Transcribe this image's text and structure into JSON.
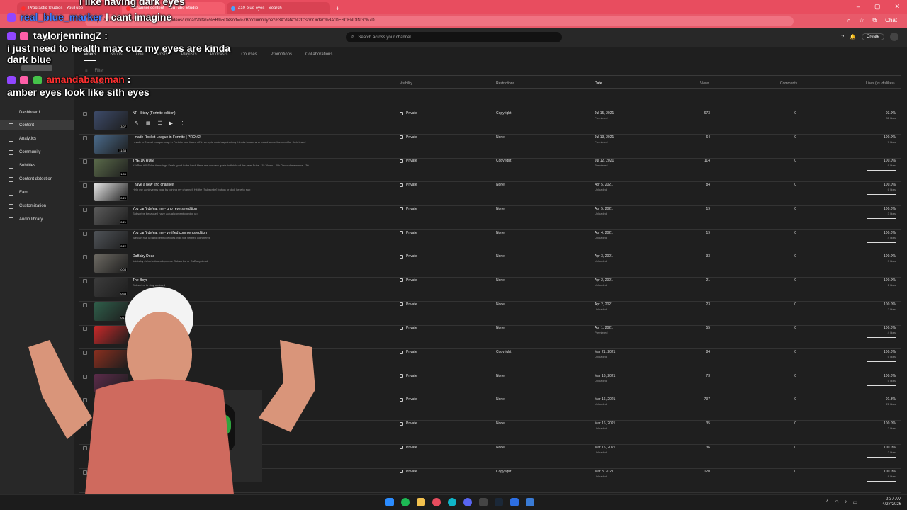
{
  "browser": {
    "tabs": [
      {
        "label": "Procrastic Studios - YouTube"
      },
      {
        "label": "Channel content - YouTube Studio"
      },
      {
        "label": "a10 blue eyes - Search"
      }
    ],
    "url": "https://studio.youtube.com/channel/UC.../videos/upload?filter=%5B%5D&sort=%7B\"columnType\"%3A\"date\"%2C\"sortOrder\"%3A\"DESCENDING\"%7D",
    "chat_button": "Chat"
  },
  "studio": {
    "search_placeholder": "Search across your channel",
    "create_label": "Create",
    "brand": "Studio"
  },
  "content_tabs": [
    "Videos",
    "Shorts",
    "Live",
    "Posts",
    "Playlists",
    "Podcasts",
    "Courses",
    "Promotions",
    "Collaborations"
  ],
  "filter_label": "Filter",
  "sidebar": {
    "items": [
      {
        "label": "Dashboard",
        "icon": "dashboard-icon"
      },
      {
        "label": "Content",
        "icon": "content-icon"
      },
      {
        "label": "Analytics",
        "icon": "analytics-icon"
      },
      {
        "label": "Community",
        "icon": "community-icon"
      },
      {
        "label": "Subtitles",
        "icon": "subtitles-icon"
      },
      {
        "label": "Content detection",
        "icon": "content-detection-icon"
      },
      {
        "label": "Earn",
        "icon": "earn-icon"
      },
      {
        "label": "Customization",
        "icon": "customization-icon"
      },
      {
        "label": "Audio library",
        "icon": "audio-library-icon"
      }
    ]
  },
  "columns": {
    "video": "Video",
    "visibility": "Visibility",
    "restrictions": "Restrictions",
    "date": "Date",
    "views": "Views",
    "comments": "Comments",
    "likes": "Likes (vs. dislikes)"
  },
  "rows": [
    {
      "title": "NF - Story (Fortnite edition)",
      "desc": "",
      "dur": "3:07",
      "vis": "Private",
      "restr": "Copyright",
      "date": "Jul 15, 2021",
      "sub": "Premiered",
      "views": "673",
      "comments": "0",
      "likes": "93.9%",
      "likes_sub": "31 likes",
      "ratio": 0.939
    },
    {
      "title": "I made Rocket League in Fortnite | PRO #2",
      "desc": "I made a Rocket League map in Fortnite and faced off in an epic match against my friends to see who would score the most for their team!",
      "dur": "11:38",
      "vis": "Private",
      "restr": "None",
      "date": "Jul 13, 2021",
      "sub": "Premiered",
      "views": "64",
      "comments": "0",
      "likes": "100.0%",
      "likes_sub": "7 likes",
      "ratio": 1.0
    },
    {
      "title": "THE 1K RUN",
      "desc": "#1kRun #1kSubs #montage Feels good to be back Here are our new goals to finish off the year Subs - 1k Views - 20k Discord members - 30",
      "dur": "1:56",
      "vis": "Private",
      "restr": "Copyright",
      "date": "Jul 12, 2021",
      "sub": "Premiered",
      "views": "114",
      "comments": "0",
      "likes": "100.0%",
      "likes_sub": "9 likes",
      "ratio": 1.0
    },
    {
      "title": "I have a new 2nd channel!",
      "desc": "Help me achieve my goal by joining my channel! Hit the [Subscribe] button or click here to sub",
      "dur": "0:29",
      "vis": "Private",
      "restr": "None",
      "date": "Apr 5, 2021",
      "sub": "Uploaded",
      "views": "84",
      "comments": "0",
      "likes": "100.0%",
      "likes_sub": "6 likes",
      "ratio": 1.0
    },
    {
      "title": "You can't defeat me - uno reverse edition",
      "desc": "Subscribe because I have actual content coming up",
      "dur": "0:21",
      "vis": "Private",
      "restr": "None",
      "date": "Apr 5, 2021",
      "sub": "Uploaded",
      "views": "19",
      "comments": "0",
      "likes": "100.0%",
      "likes_sub": "3 likes",
      "ratio": 1.0
    },
    {
      "title": "You can't defeat me - verified comments edition",
      "desc": "We can rise up and get more likes than the verified comments",
      "dur": "0:22",
      "vis": "Private",
      "restr": "None",
      "date": "Apr 4, 2021",
      "sub": "Uploaded",
      "views": "19",
      "comments": "0",
      "likes": "100.0%",
      "likes_sub": "4 likes",
      "ratio": 1.0
    },
    {
      "title": "DaBaby Dead",
      "desc": "#dababy #shorts #dababymeme Subscribe or DaBaby dead",
      "dur": "0:08",
      "vis": "Private",
      "restr": "None",
      "date": "Apr 3, 2021",
      "sub": "Uploaded",
      "views": "33",
      "comments": "0",
      "likes": "100.0%",
      "likes_sub": "3 likes",
      "ratio": 1.0
    },
    {
      "title": "The Boys",
      "desc": "Subscribe to stay updated",
      "dur": "0:38",
      "vis": "Private",
      "restr": "None",
      "date": "Apr 2, 2021",
      "sub": "Uploaded",
      "views": "21",
      "comments": "0",
      "likes": "100.0%",
      "likes_sub": "1 likes",
      "ratio": 1.0
    },
    {
      "title": "",
      "desc": "",
      "dur": "0:19",
      "vis": "Private",
      "restr": "None",
      "date": "Apr 2, 2021",
      "sub": "Uploaded",
      "views": "23",
      "comments": "0",
      "likes": "100.0%",
      "likes_sub": "2 likes",
      "ratio": 1.0
    },
    {
      "title": "",
      "desc": "",
      "dur": "",
      "vis": "Private",
      "restr": "None",
      "date": "Apr 1, 2021",
      "sub": "Premiered",
      "views": "55",
      "comments": "0",
      "likes": "100.0%",
      "likes_sub": "4 likes",
      "ratio": 1.0
    },
    {
      "title": "",
      "desc": "",
      "dur": "",
      "vis": "Private",
      "restr": "Copyright",
      "date": "Mar 21, 2021",
      "sub": "Uploaded",
      "views": "84",
      "comments": "0",
      "likes": "100.0%",
      "likes_sub": "5 likes",
      "ratio": 1.0
    },
    {
      "title": "",
      "desc": "",
      "dur": "3:31",
      "vis": "Private",
      "restr": "None",
      "date": "Mar 16, 2021",
      "sub": "Uploaded",
      "views": "73",
      "comments": "0",
      "likes": "100.0%",
      "likes_sub": "5 likes",
      "ratio": 1.0
    },
    {
      "title": "",
      "desc": "",
      "dur": "",
      "vis": "Private",
      "restr": "None",
      "date": "Mar 16, 2021",
      "sub": "Uploaded",
      "views": "737",
      "comments": "0",
      "likes": "91.3%",
      "likes_sub": "21 likes",
      "ratio": 0.913
    },
    {
      "title": "",
      "desc": "",
      "dur": "",
      "vis": "Private",
      "restr": "None",
      "date": "Mar 16, 2021",
      "sub": "Uploaded",
      "views": "35",
      "comments": "0",
      "likes": "100.0%",
      "likes_sub": "2 likes",
      "ratio": 1.0
    },
    {
      "title": "",
      "desc": "",
      "dur": "",
      "vis": "Private",
      "restr": "None",
      "date": "Mar 15, 2021",
      "sub": "Uploaded",
      "views": "36",
      "comments": "0",
      "likes": "100.0%",
      "likes_sub": "2 likes",
      "ratio": 1.0
    },
    {
      "title": "",
      "desc": "",
      "dur": "",
      "vis": "Private",
      "restr": "Copyright",
      "date": "Mar 8, 2021",
      "sub": "Uploaded",
      "views": "120",
      "comments": "0",
      "likes": "100.0%",
      "likes_sub": "8 likes",
      "ratio": 1.0
    }
  ],
  "chat": [
    {
      "user": "real_blue_marker",
      "color": "#3f7dff",
      "msg": "I cant imagine"
    },
    {
      "user": "taylorjenningZ",
      "color": "#ffffff",
      "msg": "i just need to health max cuz my eyes are kinda dark blue"
    },
    {
      "user": "amandabateman",
      "color": "#ff3030",
      "msg": "amber eyes look like sith eyes"
    }
  ],
  "chat_top_fragment": "I like having dark eyes",
  "taskbar": {
    "time": "2:37 AM",
    "date": "4/27/2026"
  },
  "colors": {
    "accent": "#e84d5f",
    "studio_bg": "#1f1f1f"
  }
}
